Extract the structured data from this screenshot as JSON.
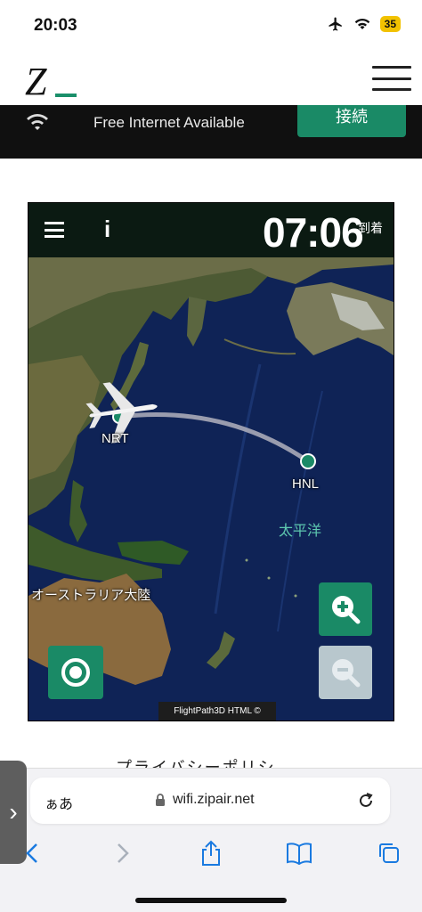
{
  "status_bar": {
    "time": "20:03",
    "battery": "35"
  },
  "header": {
    "logo": "Z"
  },
  "banner": {
    "text": "Free Internet Available",
    "connect_label": "接続"
  },
  "map": {
    "eta_time": "07:06",
    "eta_label": "到着",
    "origin_code": "NRT",
    "destination_code": "HNL",
    "ocean_label": "太平洋",
    "continent_label": "オーストラリア大陸",
    "credit": "FlightPath3D HTML ©",
    "info_label": "i",
    "colors": {
      "button": "#1a8a66",
      "button_disabled": "#b8c7cd",
      "route": "#a8aab8",
      "ocean_text": "#5ec9b0"
    }
  },
  "page": {
    "privacy_partial": "プライバシーポリシ"
  },
  "safari": {
    "aa_label": "ぁあ",
    "url": "wifi.zipair.net",
    "side_tab": "›"
  },
  "icons": [
    "airplane-mode-icon",
    "wifi-icon",
    "hamburger-icon",
    "info-icon",
    "zoom-in-icon",
    "zoom-out-icon",
    "center-icon",
    "lock-icon",
    "reload-icon",
    "back-icon",
    "forward-icon",
    "share-icon",
    "bookmarks-icon",
    "tabs-icon"
  ]
}
